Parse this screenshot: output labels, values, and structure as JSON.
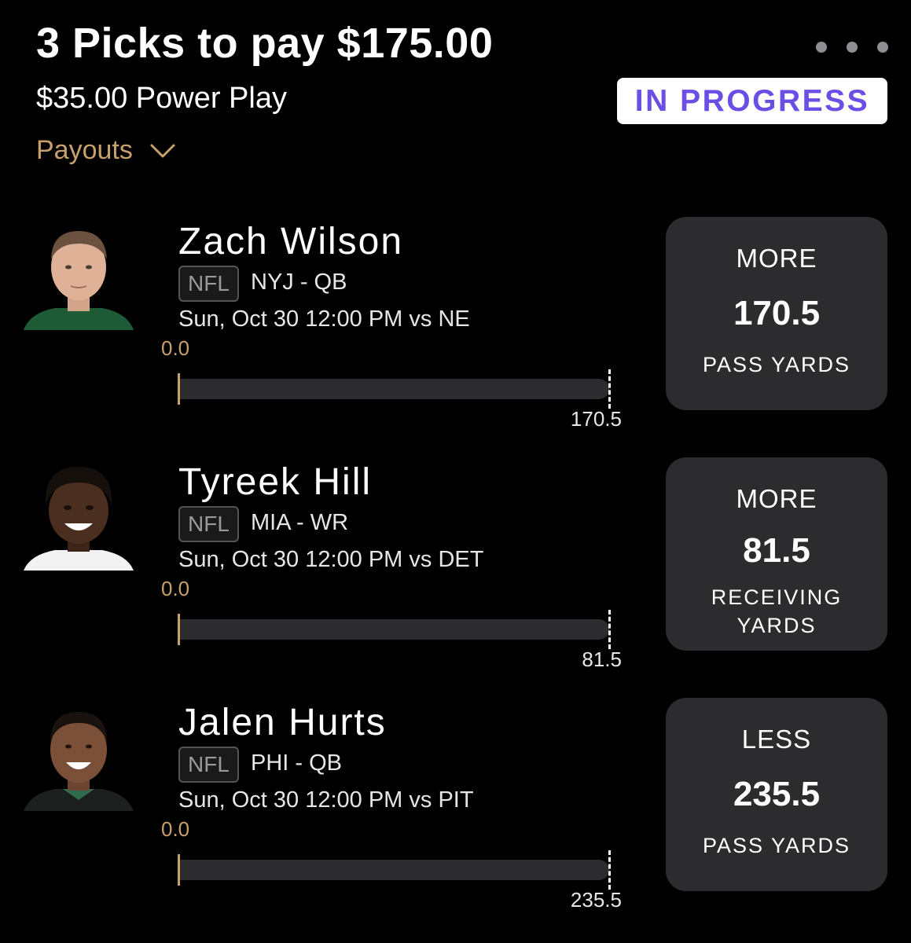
{
  "header": {
    "title": "3 Picks to pay $175.00",
    "subtitle": "$35.00 Power Play",
    "status": "IN PROGRESS",
    "payouts_label": "Payouts"
  },
  "colors": {
    "background": "#000000",
    "accent_gold": "#c8a06a",
    "status_purple": "#6b4ee6",
    "card_bg": "#2c2c2e"
  },
  "picks": [
    {
      "player": "Zach Wilson",
      "league": "NFL",
      "team_pos": "NYJ - QB",
      "game": "Sun, Oct 30 12:00 PM  vs NE",
      "current": "0.0",
      "target": "170.5",
      "progress_fraction": 0.0,
      "direction": "MORE",
      "line": "170.5",
      "stat": "PASS YARDS",
      "jersey_color": "#1f5a36"
    },
    {
      "player": "Tyreek Hill",
      "league": "NFL",
      "team_pos": "MIA - WR",
      "game": "Sun, Oct 30 12:00 PM  vs DET",
      "current": "0.0",
      "target": "81.5",
      "progress_fraction": 0.0,
      "direction": "MORE",
      "line": "81.5",
      "stat": "RECEIVING YARDS",
      "jersey_color": "#f2f2f2"
    },
    {
      "player": "Jalen Hurts",
      "league": "NFL",
      "team_pos": "PHI - QB",
      "game": "Sun, Oct 30 12:00 PM  vs PIT",
      "current": "0.0",
      "target": "235.5",
      "progress_fraction": 0.0,
      "direction": "LESS",
      "line": "235.5",
      "stat": "PASS YARDS",
      "jersey_color": "#1b1f1e"
    }
  ]
}
